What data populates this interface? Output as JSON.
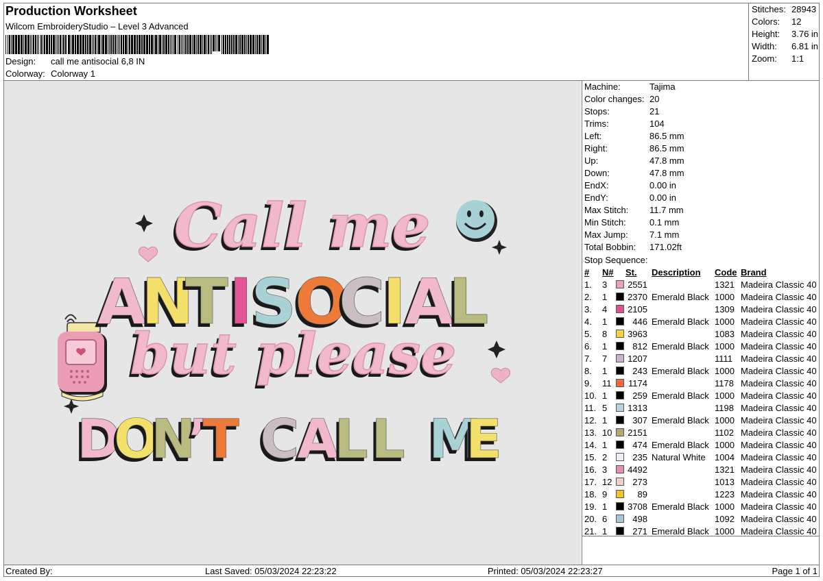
{
  "header": {
    "title": "Production Worksheet",
    "software": "Wilcom EmbroideryStudio – Level 3 Advanced",
    "design_label": "Design:",
    "design_value": "call me antisocial 6,8 IN",
    "colorway_label": "Colorway:",
    "colorway_value": "Colorway 1"
  },
  "stats": [
    {
      "label": "Stitches:",
      "value": "28943"
    },
    {
      "label": "Colors:",
      "value": "12"
    },
    {
      "label": "Height:",
      "value": "3.76 in"
    },
    {
      "label": "Width:",
      "value": "6.81 in"
    },
    {
      "label": "Zoom:",
      "value": "1:1"
    }
  ],
  "design_text": {
    "line1": "Call me",
    "line2": [
      "A",
      "N",
      "T",
      "I",
      "S",
      "O",
      "C",
      "I",
      "A",
      "L"
    ],
    "line3": "but please",
    "line4": [
      "D",
      "O",
      "N",
      "’",
      "T",
      " ",
      "C",
      "A",
      "L",
      "L",
      " ",
      "M",
      "E"
    ]
  },
  "machine_info": [
    {
      "label": "Machine:",
      "value": "Tajima"
    },
    {
      "label": "Color changes:",
      "value": "20"
    },
    {
      "label": "Stops:",
      "value": "21"
    },
    {
      "label": "Trims:",
      "value": "104"
    },
    {
      "label": "Left:",
      "value": "86.5 mm"
    },
    {
      "label": "Right:",
      "value": "86.5 mm"
    },
    {
      "label": "Up:",
      "value": "47.8 mm"
    },
    {
      "label": "Down:",
      "value": "47.8 mm"
    },
    {
      "label": "EndX:",
      "value": "0.00 in"
    },
    {
      "label": "EndY:",
      "value": "0.00 in"
    },
    {
      "label": "Max Stitch:",
      "value": "11.7 mm"
    },
    {
      "label": "Min Stitch:",
      "value": "0.1 mm"
    },
    {
      "label": "Max Jump:",
      "value": "7.1 mm"
    },
    {
      "label": "Total Bobbin:",
      "value": "171.02ft"
    }
  ],
  "stop_sequence": {
    "title": "Stop Sequence:",
    "headers": {
      "num": "#",
      "n": "N#",
      "st": "St.",
      "desc": "Description",
      "code": "Code",
      "brand": "Brand"
    },
    "rows": [
      {
        "num": "1.",
        "n": "3",
        "color": "#e9a0b8",
        "st": "2551",
        "desc": "",
        "code": "1321",
        "brand": "Madeira Classic 40"
      },
      {
        "num": "2.",
        "n": "1",
        "color": "#000000",
        "st": "2370",
        "desc": "Emerald Black",
        "code": "1000",
        "brand": "Madeira Classic 40"
      },
      {
        "num": "3.",
        "n": "4",
        "color": "#e0508e",
        "st": "2105",
        "desc": "",
        "code": "1309",
        "brand": "Madeira Classic 40"
      },
      {
        "num": "4.",
        "n": "1",
        "color": "#000000",
        "st": "446",
        "desc": "Emerald Black",
        "code": "1000",
        "brand": "Madeira Classic 40"
      },
      {
        "num": "5.",
        "n": "8",
        "color": "#f4d24a",
        "st": "3963",
        "desc": "",
        "code": "1083",
        "brand": "Madeira Classic 40"
      },
      {
        "num": "6.",
        "n": "1",
        "color": "#000000",
        "st": "812",
        "desc": "Emerald Black",
        "code": "1000",
        "brand": "Madeira Classic 40"
      },
      {
        "num": "7.",
        "n": "7",
        "color": "#c9b3cc",
        "st": "1207",
        "desc": "",
        "code": "1111",
        "brand": "Madeira Classic 40"
      },
      {
        "num": "8.",
        "n": "1",
        "color": "#000000",
        "st": "243",
        "desc": "Emerald Black",
        "code": "1000",
        "brand": "Madeira Classic 40"
      },
      {
        "num": "9.",
        "n": "11",
        "color": "#ee6a3c",
        "st": "1174",
        "desc": "",
        "code": "1178",
        "brand": "Madeira Classic 40"
      },
      {
        "num": "10.",
        "n": "1",
        "color": "#000000",
        "st": "259",
        "desc": "Emerald Black",
        "code": "1000",
        "brand": "Madeira Classic 40"
      },
      {
        "num": "11.",
        "n": "5",
        "color": "#b6d0dc",
        "st": "1313",
        "desc": "",
        "code": "1198",
        "brand": "Madeira Classic 40"
      },
      {
        "num": "12.",
        "n": "1",
        "color": "#000000",
        "st": "307",
        "desc": "Emerald Black",
        "code": "1000",
        "brand": "Madeira Classic 40"
      },
      {
        "num": "13.",
        "n": "10",
        "color": "#b3a873",
        "st": "2151",
        "desc": "",
        "code": "1102",
        "brand": "Madeira Classic 40"
      },
      {
        "num": "14.",
        "n": "1",
        "color": "#000000",
        "st": "474",
        "desc": "Emerald Black",
        "code": "1000",
        "brand": "Madeira Classic 40"
      },
      {
        "num": "15.",
        "n": "2",
        "color": "#eeeef4",
        "st": "235",
        "desc": "Natural White",
        "code": "1004",
        "brand": "Madeira Classic 40"
      },
      {
        "num": "16.",
        "n": "3",
        "color": "#de8fb0",
        "st": "4492",
        "desc": "",
        "code": "1321",
        "brand": "Madeira Classic 40"
      },
      {
        "num": "17.",
        "n": "12",
        "color": "#f0d0c8",
        "st": "273",
        "desc": "",
        "code": "1013",
        "brand": "Madeira Classic 40"
      },
      {
        "num": "18.",
        "n": "9",
        "color": "#f2c52a",
        "st": "89",
        "desc": "",
        "code": "1223",
        "brand": "Madeira Classic 40"
      },
      {
        "num": "19.",
        "n": "1",
        "color": "#000000",
        "st": "3708",
        "desc": "Emerald Black",
        "code": "1000",
        "brand": "Madeira Classic 40"
      },
      {
        "num": "20.",
        "n": "6",
        "color": "#a8c8d8",
        "st": "498",
        "desc": "",
        "code": "1092",
        "brand": "Madeira Classic 40"
      },
      {
        "num": "21.",
        "n": "1",
        "color": "#000000",
        "st": "271",
        "desc": "Emerald Black",
        "code": "1000",
        "brand": "Madeira Classic 40"
      }
    ]
  },
  "footer": {
    "created_by": "Created By:",
    "last_saved": "Last Saved: 05/03/2024 22:23:22",
    "printed": "Printed: 05/03/2024 22:23:27",
    "page": "Page 1 of 1"
  },
  "colors": {
    "pink": "#f2b9cc",
    "yellow": "#f2e06a",
    "olive": "#b9bb80",
    "hotpink": "#e5559a",
    "blue": "#a9d2d6",
    "orange": "#ee7a3a",
    "mauve": "#cbbec2",
    "shadow": "#1a1a1a"
  }
}
